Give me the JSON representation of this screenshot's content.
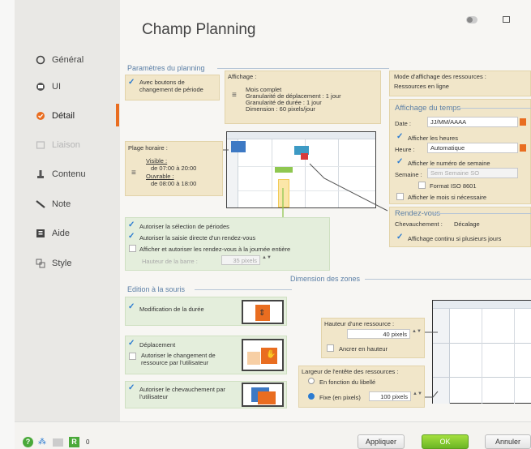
{
  "window": {
    "title": "Champ Planning"
  },
  "nav": [
    {
      "label": "Général",
      "icon": "circle-outline-icon"
    },
    {
      "label": "UI",
      "icon": "ui-icon"
    },
    {
      "label": "Détail",
      "icon": "detail-icon"
    },
    {
      "label": "Liaison",
      "icon": "link-icon"
    },
    {
      "label": "Contenu",
      "icon": "content-icon"
    },
    {
      "label": "Note",
      "icon": "note-icon"
    },
    {
      "label": "Aide",
      "icon": "help-icon"
    },
    {
      "label": "Style",
      "icon": "style-icon"
    }
  ],
  "planning": {
    "section_label": "Paramètres du planning",
    "period_buttons": "Avec boutons de changement de période",
    "display_label": "Affichage :",
    "display_lines": [
      "Mois complet",
      "Granularité de déplacement : 1 jour",
      "Granularité de durée : 1 jour",
      "Dimension : 60 pixels/jour"
    ],
    "hours_label": "Plage horaire :",
    "visible_label": "Visible :",
    "visible_value": "de 07:00 à 20:00",
    "workable_label": "Ouvrable :",
    "workable_value": "de 08:00 à 18:00",
    "allow_period_select": "Autoriser la sélection de périodes",
    "allow_direct_input": "Autoriser la saisie directe d'un rendez-vous",
    "allow_full_day": "Afficher et autoriser les rendez-vous à la journée entière",
    "bar_height_label": "Hauteur de la barre :",
    "bar_height_value": "35 pixels"
  },
  "resources_display": {
    "mode_label": "Mode d'affichage des ressources :",
    "mode_value": "Ressources en ligne"
  },
  "time_display": {
    "section_label": "Affichage du temps",
    "date_label": "Date :",
    "date_value": "JJ/MM/AAAA",
    "show_hours": "Afficher les heures",
    "hour_label": "Heure :",
    "hour_value": "Automatique",
    "show_week": "Afficher le numéro de semaine",
    "week_label": "Semaine :",
    "week_value": "Sem Semaine SO",
    "iso_format": "Format ISO 8601",
    "show_month": "Afficher le mois si nécessaire"
  },
  "appointments": {
    "section_label": "Rendez-vous",
    "overlap_label": "Chevauchement :",
    "overlap_value": "Décalage",
    "continuous": "Affichage continu si plusieurs jours"
  },
  "zones": {
    "section_label": "Dimension des zones",
    "row_height_label": "Hauteur d'une ressource :",
    "row_height_value": "40 pixels",
    "anchor_height": "Ancrer en hauteur",
    "header_width_label": "Largeur de l'entête des ressources :",
    "by_label": "En fonction du libellé",
    "fixed_label": "Fixe (en pixels)",
    "fixed_value": "100 pixels"
  },
  "mouse": {
    "section_label": "Edition à la souris",
    "duration": "Modification de la durée",
    "move": "Déplacement",
    "change_resource": "Autoriser le changement de ressource par l'utilisateur",
    "overlap": "Autoriser le chevauchement par l'utilisateur"
  },
  "buttons": {
    "apply": "Appliquer",
    "ok": "OK",
    "cancel": "Annuler"
  },
  "bottom": {
    "counter": "0"
  },
  "colors": {
    "accent": "#e96d20",
    "section": "#5b7fa6",
    "ok": "#7cc52d"
  }
}
